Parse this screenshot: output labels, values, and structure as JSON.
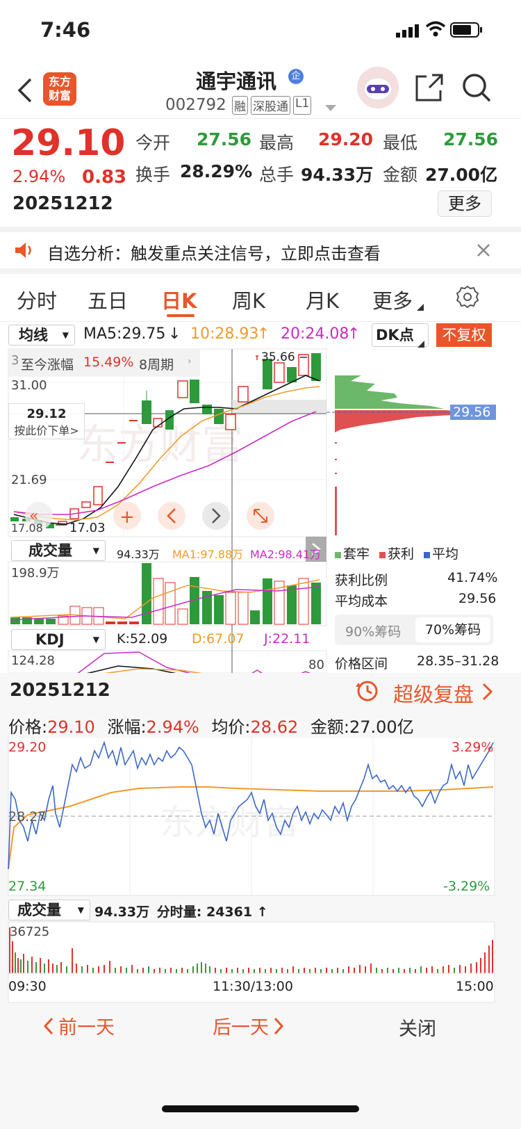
{
  "status_bar": {
    "time": "7:46"
  },
  "header": {
    "logo_text": "东方\n财富",
    "stock_name": "通宇通讯",
    "company_badge": "企",
    "stock_code": "002792",
    "tags": [
      "融",
      "深股通",
      "L1"
    ]
  },
  "quote": {
    "price": "29.10",
    "change_pct": "2.94%",
    "change": "0.83",
    "date": "20251212",
    "fields": [
      {
        "label": "今开",
        "value": "27.56",
        "color": "green"
      },
      {
        "label": "最高",
        "value": "29.20",
        "color": "red"
      },
      {
        "label": "最低",
        "value": "27.56",
        "color": "green"
      },
      {
        "label": "换手",
        "value": "28.29%",
        "color": "dark"
      },
      {
        "label": "总手",
        "value": "94.33万",
        "color": "dark"
      },
      {
        "label": "金额",
        "value": "27.00亿",
        "color": "dark"
      }
    ],
    "more_label": "更多"
  },
  "banner": {
    "text": "自选分析：触发重点关注信号，立即点击查看"
  },
  "tabs": {
    "items": [
      "分时",
      "五日",
      "日K",
      "周K",
      "月K",
      "更多"
    ],
    "active": "日K"
  },
  "kline": {
    "ma_select": "均线",
    "ma5": "MA5:29.75",
    "ma10": "10:28.93",
    "ma20": "20:24.08",
    "dk_label": "DK点",
    "fq_label": "不复权",
    "gain_label": "至今涨幅",
    "gain_value": "15.49%",
    "gain_period": "8周期",
    "y_top": "31.00",
    "y_mid": "21.69",
    "y_low": "17.03",
    "y_low_left": "17.08",
    "high_label": "35.66",
    "cursor_price": "29.12",
    "cursor_action": "按此价下单>",
    "chip_price": "29.56",
    "left_stub": "3"
  },
  "volume": {
    "select": "成交量",
    "total": "94.33万",
    "ma1": "MA1:97.88万",
    "ma2": "MA2:98.41万",
    "max": "198.9万"
  },
  "kdj": {
    "select": "KDJ",
    "k": "K:52.09",
    "d": "D:67.07",
    "j": "J:22.11",
    "top": "124.28",
    "level": "80"
  },
  "chips": {
    "legend": [
      "套牢",
      "获利",
      "平均"
    ],
    "profit_ratio_label": "获利比例",
    "profit_ratio": "41.74%",
    "avg_cost_label": "平均成本",
    "avg_cost": "29.56",
    "tab90": "90%筹码",
    "tab70": "70%筹码",
    "range_label": "价格区间",
    "range": "28.35–31.28"
  },
  "replay": {
    "date": "20251212",
    "link": "超级复盘",
    "price_label": "价格:",
    "price": "29.10",
    "change_label": "涨幅:",
    "change": "2.94%",
    "avg_label": "均价:",
    "avg": "28.62",
    "amount_label": "金额:",
    "amount": "27.00亿",
    "y_top": "29.20",
    "y_mid": "28.27",
    "y_bottom": "27.34",
    "pct_top": "3.29%",
    "pct_bottom": "-3.29%",
    "vol_select": "成交量",
    "vol_total": "94.33万",
    "vol_tick_label": "分时量:",
    "vol_tick": "24361",
    "vol_max": "36725",
    "t_start": "09:30",
    "t_mid": "11:30/13:00",
    "t_end": "15:00"
  },
  "footer": {
    "prev": "前一天",
    "next": "后一天",
    "close": "关闭"
  },
  "colors": {
    "red": "#e0312a",
    "green": "#2e9a3b",
    "orange": "#f29a29",
    "blue": "#3b67c5",
    "accent": "#e8562a"
  }
}
